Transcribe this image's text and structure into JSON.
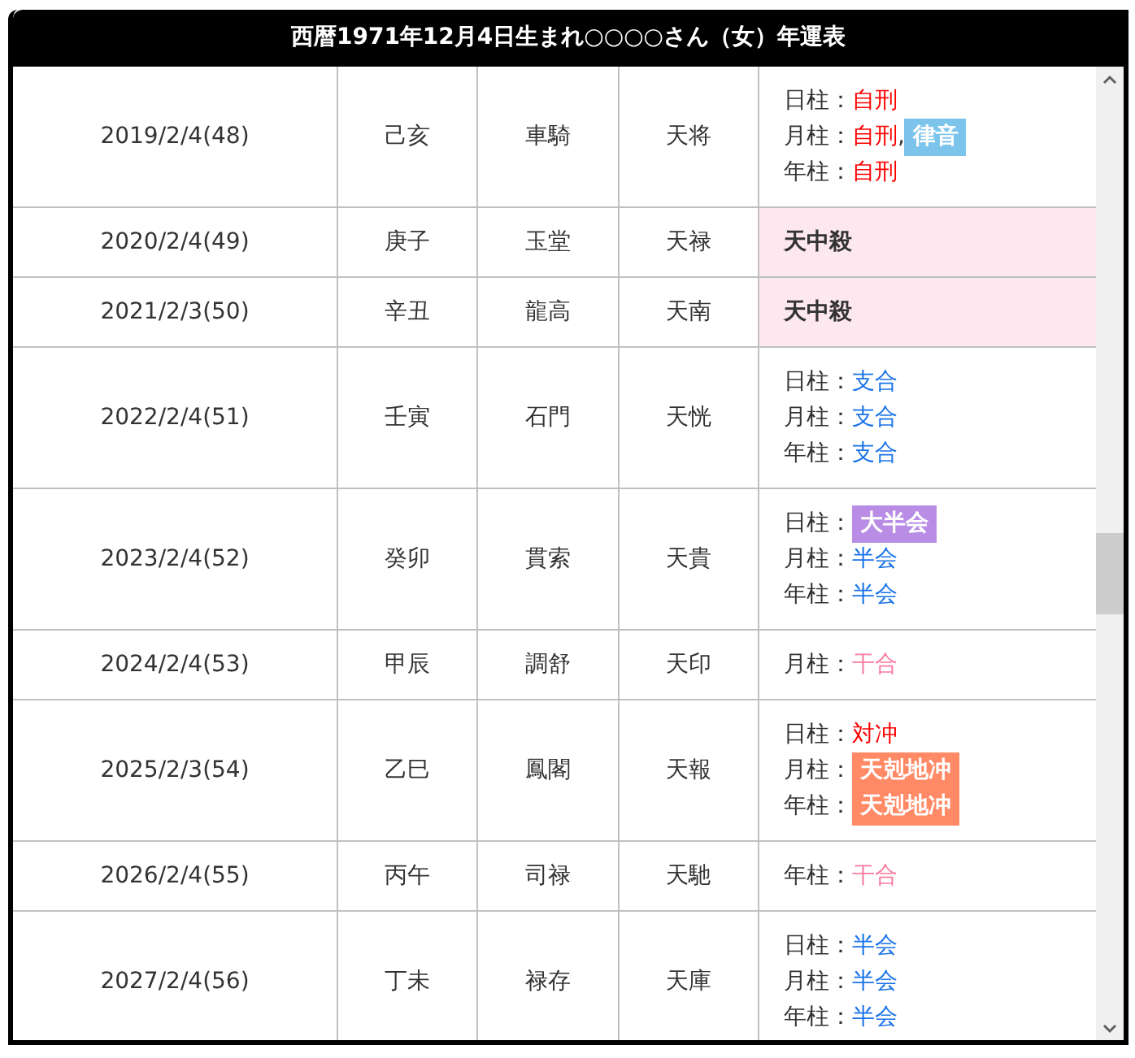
{
  "title": "西暦1971年12月4日生まれ○○○○さん（女）年運表",
  "rows": [
    {
      "date": "2019/2/4(48)",
      "kanshi": "己亥",
      "star_1": "車騎",
      "star_2": "天将",
      "highlight": false,
      "lines": [
        {
          "kind": "pillar",
          "label": "日柱：",
          "items": [
            {
              "kind": "text",
              "text": "自刑",
              "color": "#ff0000"
            }
          ]
        },
        {
          "kind": "pillar",
          "label": "月柱：",
          "items": [
            {
              "kind": "text",
              "text": "自刑",
              "color": "#ff0000"
            },
            {
              "kind": "text",
              "text": ",",
              "color": "#333333"
            },
            {
              "kind": "badge",
              "text": "律音",
              "color": "#7cc4ec"
            }
          ]
        },
        {
          "kind": "pillar",
          "label": "年柱：",
          "items": [
            {
              "kind": "text",
              "text": "自刑",
              "color": "#ff0000"
            }
          ]
        }
      ]
    },
    {
      "date": "2020/2/4(49)",
      "kanshi": "庚子",
      "star_1": "玉堂",
      "star_2": "天禄",
      "highlight": true,
      "lines": [
        {
          "kind": "bold",
          "label": "天中殺"
        }
      ]
    },
    {
      "date": "2021/2/3(50)",
      "kanshi": "辛丑",
      "star_1": "龍高",
      "star_2": "天南",
      "highlight": true,
      "lines": [
        {
          "kind": "bold",
          "label": "天中殺"
        }
      ]
    },
    {
      "date": "2022/2/4(51)",
      "kanshi": "壬寅",
      "star_1": "石門",
      "star_2": "天恍",
      "highlight": false,
      "lines": [
        {
          "kind": "pillar",
          "label": "日柱：",
          "items": [
            {
              "kind": "text",
              "text": "支合",
              "color": "#1a73e8"
            }
          ]
        },
        {
          "kind": "pillar",
          "label": "月柱：",
          "items": [
            {
              "kind": "text",
              "text": "支合",
              "color": "#1a73e8"
            }
          ]
        },
        {
          "kind": "pillar",
          "label": "年柱：",
          "items": [
            {
              "kind": "text",
              "text": "支合",
              "color": "#1a73e8"
            }
          ]
        }
      ]
    },
    {
      "date": "2023/2/4(52)",
      "kanshi": "癸卯",
      "star_1": "貫索",
      "star_2": "天貴",
      "highlight": false,
      "lines": [
        {
          "kind": "pillar",
          "label": "日柱：",
          "items": [
            {
              "kind": "badge",
              "text": "大半会",
              "color": "#b98ce6"
            }
          ]
        },
        {
          "kind": "pillar",
          "label": "月柱：",
          "items": [
            {
              "kind": "text",
              "text": "半会",
              "color": "#1a73e8"
            }
          ]
        },
        {
          "kind": "pillar",
          "label": "年柱：",
          "items": [
            {
              "kind": "text",
              "text": "半会",
              "color": "#1a73e8"
            }
          ]
        }
      ]
    },
    {
      "date": "2024/2/4(53)",
      "kanshi": "甲辰",
      "star_1": "調舒",
      "star_2": "天印",
      "highlight": false,
      "lines": [
        {
          "kind": "pillar",
          "label": "月柱：",
          "items": [
            {
              "kind": "text",
              "text": "干合",
              "color": "#f77ca0"
            }
          ]
        }
      ]
    },
    {
      "date": "2025/2/3(54)",
      "kanshi": "乙巳",
      "star_1": "鳳閣",
      "star_2": "天報",
      "highlight": false,
      "lines": [
        {
          "kind": "pillar",
          "label": "日柱：",
          "items": [
            {
              "kind": "text",
              "text": "対冲",
              "color": "#ff0000"
            }
          ]
        },
        {
          "kind": "pillar",
          "label": "月柱：",
          "items": [
            {
              "kind": "badge",
              "text": "天剋地冲",
              "color": "#ff8a65"
            }
          ]
        },
        {
          "kind": "pillar",
          "label": "年柱：",
          "items": [
            {
              "kind": "badge",
              "text": "天剋地冲",
              "color": "#ff8a65"
            }
          ]
        }
      ]
    },
    {
      "date": "2026/2/4(55)",
      "kanshi": "丙午",
      "star_1": "司禄",
      "star_2": "天馳",
      "highlight": false,
      "lines": [
        {
          "kind": "pillar",
          "label": "年柱：",
          "items": [
            {
              "kind": "text",
              "text": "干合",
              "color": "#f77ca0"
            }
          ]
        }
      ]
    },
    {
      "date": "2027/2/4(56)",
      "kanshi": "丁未",
      "star_1": "禄存",
      "star_2": "天庫",
      "highlight": false,
      "lines": [
        {
          "kind": "pillar",
          "label": "日柱：",
          "items": [
            {
              "kind": "text",
              "text": "半会",
              "color": "#1a73e8"
            }
          ]
        },
        {
          "kind": "pillar",
          "label": "月柱：",
          "items": [
            {
              "kind": "text",
              "text": "半会",
              "color": "#1a73e8"
            }
          ]
        },
        {
          "kind": "pillar",
          "label": "年柱：",
          "items": [
            {
              "kind": "text",
              "text": "半会",
              "color": "#1a73e8"
            }
          ]
        }
      ]
    }
  ]
}
